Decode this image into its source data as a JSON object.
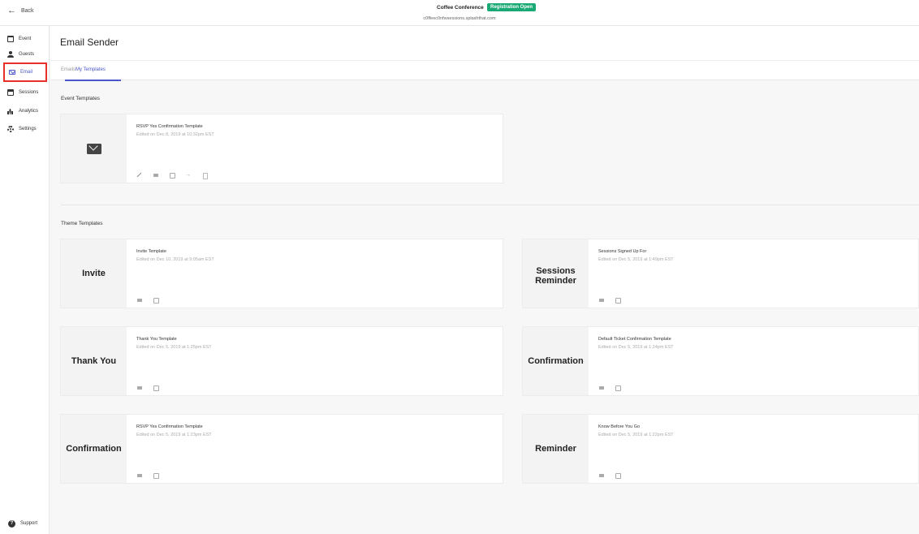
{
  "topbar": {
    "back_label": "Back",
    "event_title": "Coffee Conference",
    "status_badge": "Registration Open",
    "event_url": "c0ffeec0nfwsessions.splashthat.com"
  },
  "sidebar": {
    "items": [
      {
        "label": "Event",
        "icon": "calendar-icon"
      },
      {
        "label": "Guests",
        "icon": "person-icon"
      },
      {
        "label": "Email",
        "icon": "mail-icon"
      },
      {
        "label": "Sessions",
        "icon": "calendar-grid-icon"
      },
      {
        "label": "Analytics",
        "icon": "bar-chart-icon"
      },
      {
        "label": "Settings",
        "icon": "gear-icon"
      }
    ],
    "active": "Email",
    "support_label": "Support"
  },
  "main": {
    "title": "Email Sender",
    "tabs": [
      {
        "label": "Emails"
      },
      {
        "label": "My Templates"
      }
    ],
    "active_tab": "My Templates",
    "event_templates": {
      "title": "Event Templates",
      "cards": [
        {
          "name": "RSVP Yes Confirmation Template",
          "edited": "Edited on Dec 8, 2019 at 10:32pm EST"
        }
      ]
    },
    "theme_templates": {
      "title": "Theme Templates",
      "cards": [
        {
          "thumb": "Invite",
          "name": "Invite Template",
          "edited": "Edited on Dec 10, 2019 at 9:05am EST"
        },
        {
          "thumb": "Sessions Reminder",
          "name": "Sessions Signed Up For",
          "edited": "Edited on Dec 5, 2019 at 1:49pm EST"
        },
        {
          "thumb": "Thank You",
          "name": "Thank You Template",
          "edited": "Edited on Dec 5, 2019 at 1:25pm EST"
        },
        {
          "thumb": "Confirmation",
          "name": "Default Ticket Confirmation Template",
          "edited": "Edited on Dec 5, 2019 at 1:24pm EST"
        },
        {
          "thumb": "Confirmation",
          "name": "RSVP Yes Confirmation Template",
          "edited": "Edited on Dec 5, 2019 at 1:23pm EST"
        },
        {
          "thumb": "Reminder",
          "name": "Know Before You Go",
          "edited": "Edited on Dec 5, 2019 at 1:22pm EST"
        }
      ]
    }
  },
  "colors": {
    "accent": "#4a56c9",
    "badge_green": "#19a974",
    "highlight_red": "#e8302a"
  }
}
